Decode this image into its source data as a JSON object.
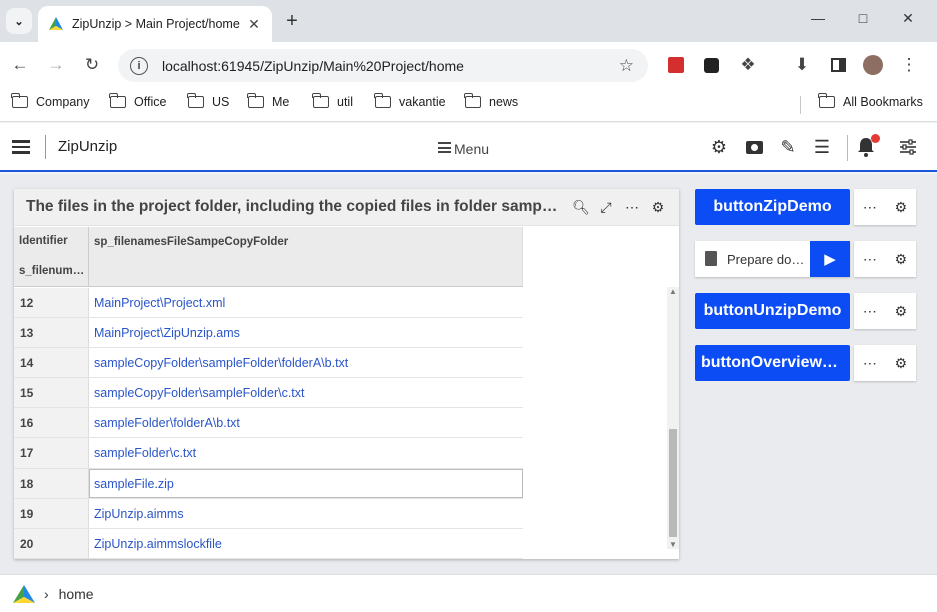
{
  "browser": {
    "tab_title": "ZipUnzip > Main Project/home",
    "url": "localhost:61945/ZipUnzip/Main%20Project/home",
    "bookmarks": [
      "Company",
      "Office",
      "US",
      "Me",
      "util",
      "vakantie",
      "news"
    ],
    "all_bookmarks": "All Bookmarks"
  },
  "app": {
    "name": "ZipUnzip",
    "menu_label": "Menu",
    "accent": "#1a56db"
  },
  "widget": {
    "title": "The files in the project folder, including the copied files in folder sampleCopyFolder",
    "col_identifier": "Identifier",
    "col_index": "s_filenumber",
    "col_value": "sp_filenamesFileSampeCopyFolder",
    "rows": [
      {
        "id": "12",
        "value": "MainProject\\Project.xml"
      },
      {
        "id": "13",
        "value": "MainProject\\ZipUnzip.ams"
      },
      {
        "id": "14",
        "value": "sampleCopyFolder\\sampleFolder\\folderA\\b.txt"
      },
      {
        "id": "15",
        "value": "sampleCopyFolder\\sampleFolder\\c.txt"
      },
      {
        "id": "16",
        "value": "sampleFolder\\folderA\\b.txt"
      },
      {
        "id": "17",
        "value": "sampleFolder\\c.txt"
      },
      {
        "id": "18",
        "value": "sampleFile.zip"
      },
      {
        "id": "19",
        "value": "ZipUnzip.aimms"
      },
      {
        "id": "20",
        "value": "ZipUnzip.aimmslockfile"
      }
    ]
  },
  "buttons": {
    "zip_demo": "buttonZipDemo",
    "prepare": "Prepare download",
    "unzip_demo": "buttonUnzipDemo",
    "overview": "buttonOverviewCopy",
    "button_color": "#0b4cf5"
  },
  "footer": {
    "crumb": "home"
  }
}
